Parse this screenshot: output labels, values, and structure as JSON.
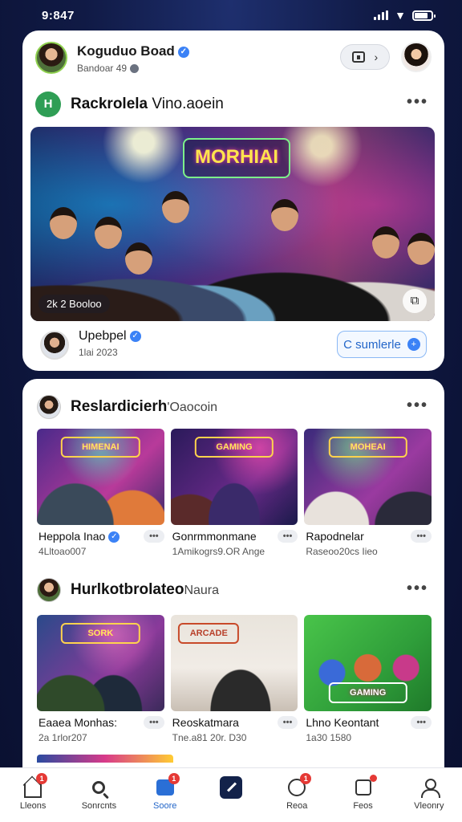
{
  "status": {
    "time": "9:847"
  },
  "profile": {
    "name": "Koguduo Boad",
    "sub": "Bandoar 49"
  },
  "post": {
    "page_title": "Rackrolela",
    "page_title_light": "Vino.aoein",
    "page_logo": "H",
    "hero_sign": "MORHIAI",
    "hero_caption": "2k 2 Booloo",
    "author": "Upebpel",
    "author_time": "1lai 2023",
    "follow_label": "C sumlerle"
  },
  "section1": {
    "title": "Reslardicierh",
    "title_light": "'Oaocoin",
    "items": [
      {
        "label": "Heppola Inao",
        "sub": "4Lltoao007",
        "badge": "•••",
        "sign": "HIMENAI"
      },
      {
        "label": "Gonrmmonmane",
        "sub": "1Amikogrs9.OR Ange",
        "badge": "•••",
        "sign": "GAMING"
      },
      {
        "label": "Rapodnelar",
        "sub": "Raseoo20cs Iieo",
        "badge": "•••",
        "sign": "MOHEAI"
      }
    ]
  },
  "section2": {
    "title": "Hurlkotbrolateo",
    "title_light": "Naura",
    "items": [
      {
        "label": "Eaaea Monhas:",
        "sub": "2a 1rlor207",
        "badge": "•••",
        "sign": "SORK"
      },
      {
        "label": "Reoskatmara",
        "sub": "Tne.a81 20r. D30",
        "badge": "•••",
        "sign": "ARCADE"
      },
      {
        "label": "Lhno Keontant",
        "sub": "1a30 1580",
        "badge": "•••",
        "sign": "GAMING"
      }
    ]
  },
  "nav": [
    {
      "label": "Lleons",
      "icon": "home-icon",
      "badge": "1"
    },
    {
      "label": "Sonrcnts",
      "icon": "search-icon",
      "badge": ""
    },
    {
      "label": "Soore",
      "icon": "store-icon",
      "badge": "1",
      "active": true
    },
    {
      "label": "",
      "icon": "post-icon",
      "badge": ""
    },
    {
      "label": "Reoa",
      "icon": "face-icon",
      "badge": "1"
    },
    {
      "label": "Feos",
      "icon": "bell-icon",
      "badge": ""
    },
    {
      "label": "Vleonry",
      "icon": "user-icon",
      "badge": ""
    }
  ],
  "colors": {
    "accent": "#2366c9",
    "badge": "#e53935",
    "brand_green": "#2f9e55"
  }
}
